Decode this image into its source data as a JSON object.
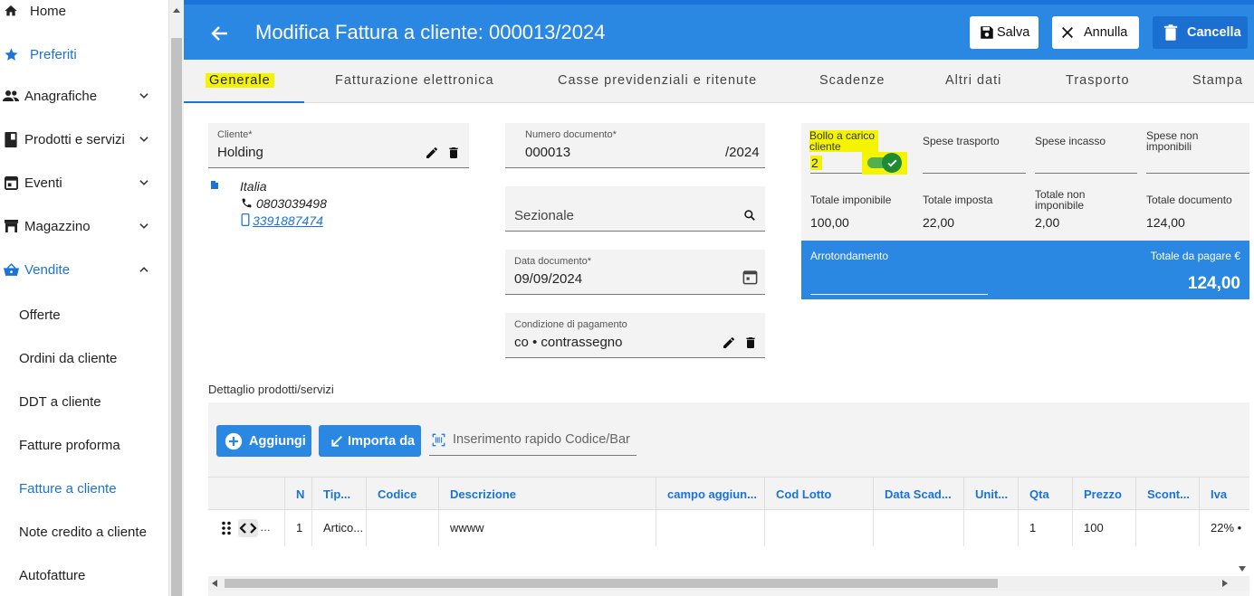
{
  "colors": {
    "primary": "#2a88e3",
    "active": "#1a73d9",
    "highlight": "#f4f400",
    "toggle": "#1f8a35"
  },
  "sidebar": {
    "items": [
      {
        "label": "Home",
        "icon": "home-icon"
      },
      {
        "label": "Preferiti",
        "icon": "star-icon"
      },
      {
        "label": "Anagrafiche",
        "icon": "people-icon"
      },
      {
        "label": "Prodotti e servizi",
        "icon": "book-icon"
      },
      {
        "label": "Eventi",
        "icon": "calendar-icon"
      },
      {
        "label": "Magazzino",
        "icon": "warehouse-icon"
      },
      {
        "label": "Vendite",
        "icon": "basket-icon"
      }
    ],
    "subitems": [
      "Offerte",
      "Ordini da cliente",
      "DDT a cliente",
      "Fatture proforma",
      "Fatture a cliente",
      "Note credito a cliente",
      "Autofatture"
    ]
  },
  "header": {
    "title": "Modifica Fattura a cliente: 000013/2024",
    "save_label": "Salva",
    "cancel_label": "Annulla",
    "delete_label": "Cancella"
  },
  "tabs": [
    "Generale",
    "Fatturazione elettronica",
    "Casse previdenziali e ritenute",
    "Scadenze",
    "Altri dati",
    "Trasporto",
    "Stampa"
  ],
  "form": {
    "cliente": {
      "label": "Cliente*",
      "value": "Holding"
    },
    "client_info": {
      "country": "Italia",
      "phone": "0803039498",
      "mobile": "3391887474"
    },
    "numero": {
      "label": "Numero documento*",
      "value": "000013",
      "suffix": "/2024"
    },
    "sezionale": {
      "placeholder": "Sezionale"
    },
    "data": {
      "label": "Data documento*",
      "value": "09/09/2024"
    },
    "pagamento": {
      "label": "Condizione di pagamento",
      "value": "co • contrassegno"
    }
  },
  "totals": {
    "bollo_label": "Bollo a carico cliente",
    "bollo_value": "2",
    "bollo_enabled": true,
    "spese_trasporto": "Spese trasporto",
    "spese_incasso": "Spese incasso",
    "spese_non_imponibili": "Spese non imponibili",
    "imponibile_label": "Totale imponibile",
    "imponibile": "100,00",
    "imposta_label": "Totale imposta",
    "imposta": "22,00",
    "non_imponibile_label": "Totale non imponibile",
    "non_imponibile": "2,00",
    "documento_label": "Totale documento",
    "documento": "124,00",
    "arrotondamento_label": "Arrotondamento",
    "da_pagare_label": "Totale da pagare €",
    "da_pagare": "124,00"
  },
  "detail": {
    "title": "Dettaglio prodotti/servizi",
    "add_label": "Aggiungi",
    "import_label": "Importa da",
    "quick_placeholder": "Inserimento rapido Codice/Bar",
    "columns": [
      "N",
      "Tip...",
      "Codice",
      "Descrizione",
      "campo aggiun...",
      "Cod Lotto",
      "Data Scad...",
      "Unit...",
      "Qta",
      "Prezzo",
      "Scont...",
      "Iva"
    ],
    "rows": [
      {
        "n": "1",
        "tipo": "Artico...",
        "codice": "",
        "descrizione": "wwww",
        "campo": "",
        "lotto": "",
        "scadenza": "",
        "unita": "",
        "qta": "1",
        "prezzo": "100",
        "sconto": "",
        "iva": "22% •"
      }
    ]
  }
}
